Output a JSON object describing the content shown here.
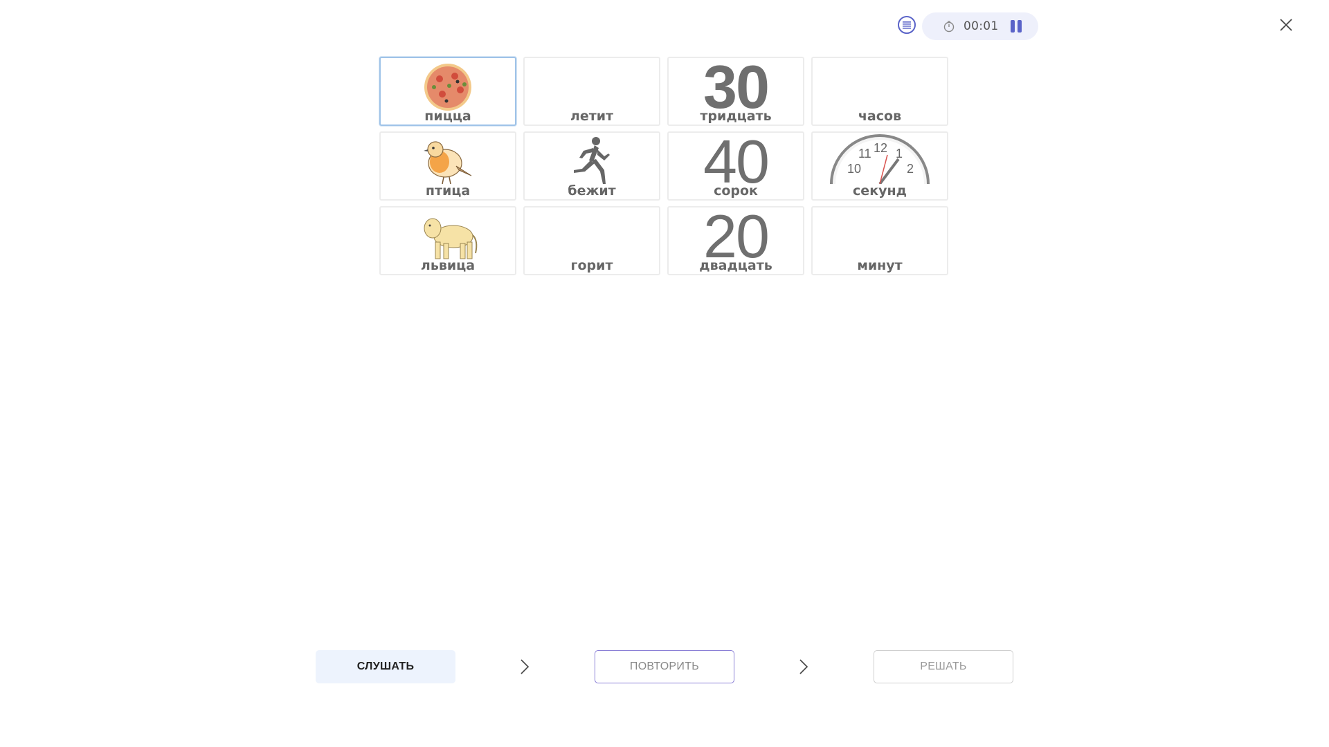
{
  "header": {
    "list_icon": "list-icon",
    "timer": {
      "icon": "stopwatch-icon",
      "value": "00:01"
    },
    "pause_icon": "pause-icon",
    "close_icon": "close-icon"
  },
  "cards": [
    {
      "label": "пицца",
      "picture": "pizza",
      "selected": true
    },
    {
      "label": "летит",
      "picture": "none"
    },
    {
      "label": "тридцать",
      "picture": "number",
      "number": "30"
    },
    {
      "label": "часов",
      "picture": "none"
    },
    {
      "label": "птица",
      "picture": "bird"
    },
    {
      "label": "бежит",
      "picture": "runner"
    },
    {
      "label": "сорок",
      "picture": "number",
      "number": "40"
    },
    {
      "label": "секунд",
      "picture": "clock"
    },
    {
      "label": "львица",
      "picture": "lioness"
    },
    {
      "label": "горит",
      "picture": "none"
    },
    {
      "label": "двадцать",
      "picture": "number",
      "number": "20"
    },
    {
      "label": "минут",
      "picture": "none"
    }
  ],
  "clock_numbers": [
    "10",
    "11",
    "12",
    "1",
    "2"
  ],
  "steps": {
    "listen": "СЛУШАТЬ",
    "repeat": "ПОВТОРИТЬ",
    "solve": "РЕШАТЬ"
  },
  "colors": {
    "accent": "#5a63c8",
    "listen_bg": "#edf3fd",
    "selected_border": "#9fc3e8"
  }
}
